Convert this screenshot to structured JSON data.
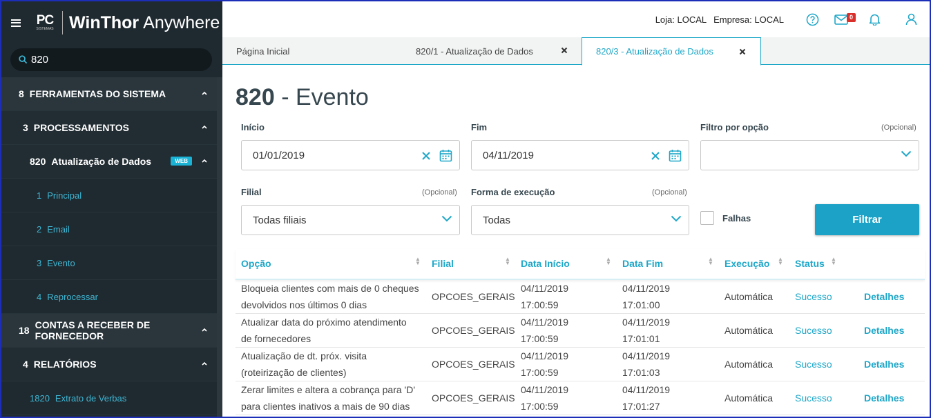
{
  "app": {
    "logo_text": "PC",
    "logo_subtext": "SISTEMAS",
    "brand_strong": "WinThor",
    "brand_light": "Anywhere"
  },
  "search": {
    "value": "820"
  },
  "menu": [
    {
      "number": "8",
      "label": "FERRAMENTAS DO SISTEMA",
      "level": 0
    },
    {
      "number": "3",
      "label": "PROCESSAMENTOS",
      "level": 1
    },
    {
      "number": "820",
      "label": "Atualização de Dados",
      "level": 2,
      "badge": "WEB"
    },
    {
      "number": "1",
      "label": "Principal",
      "level": 3
    },
    {
      "number": "2",
      "label": "Email",
      "level": 3
    },
    {
      "number": "3",
      "label": "Evento",
      "level": 3
    },
    {
      "number": "4",
      "label": "Reprocessar",
      "level": 3
    },
    {
      "number": "18",
      "label": "CONTAS A RECEBER DE FORNECEDOR",
      "level": 0
    },
    {
      "number": "4",
      "label": "RELATÓRIOS",
      "level": 1
    },
    {
      "number": "1820",
      "label": "Extrato de Verbas",
      "level": 4
    }
  ],
  "header": {
    "loja": "Loja: LOCAL",
    "empresa": "Empresa: LOCAL",
    "mail_count": "0"
  },
  "tabs": [
    {
      "label": "Página Inicial"
    },
    {
      "label": "820/1 - Atualização de Dados"
    },
    {
      "label": "820/3 - Atualização de Dados",
      "active": true
    }
  ],
  "page": {
    "title_number": "820",
    "title_text": "- Evento"
  },
  "form": {
    "inicio_label": "Início",
    "inicio_value": "01/01/2019",
    "fim_label": "Fim",
    "fim_value": "04/11/2019",
    "filtro_label": "Filtro por opção",
    "filtro_optional": "(Opcional)",
    "filtro_value": "",
    "filial_label": "Filial",
    "filial_optional": "(Opcional)",
    "filial_value": "Todas filiais",
    "forma_label": "Forma de execução",
    "forma_optional": "(Opcional)",
    "forma_value": "Todas",
    "falhas_label": "Falhas",
    "filtrar_button": "Filtrar"
  },
  "table": {
    "columns": [
      "Opção",
      "Filial",
      "Data Início",
      "Data Fim",
      "Execução",
      "Status"
    ],
    "rows": [
      {
        "opcao": [
          "Bloqueia clientes com mais de 0 cheques",
          "devolvidos nos últimos 0 dias"
        ],
        "filial": "OPCOES_GERAIS",
        "inicio": [
          "04/11/2019",
          "17:00:59"
        ],
        "fim": [
          "04/11/2019",
          "17:01:00"
        ],
        "execucao": "Automática",
        "status": "Sucesso",
        "acao": "Detalhes"
      },
      {
        "opcao": [
          "Atualizar data do próximo atendimento",
          "de fornecedores"
        ],
        "filial": "OPCOES_GERAIS",
        "inicio": [
          "04/11/2019",
          "17:00:59"
        ],
        "fim": [
          "04/11/2019",
          "17:01:01"
        ],
        "execucao": "Automática",
        "status": "Sucesso",
        "acao": "Detalhes"
      },
      {
        "opcao": [
          "Atualização de dt. próx. visita",
          "(roteirização de clientes)"
        ],
        "filial": "OPCOES_GERAIS",
        "inicio": [
          "04/11/2019",
          "17:00:59"
        ],
        "fim": [
          "04/11/2019",
          "17:01:03"
        ],
        "execucao": "Automática",
        "status": "Sucesso",
        "acao": "Detalhes"
      },
      {
        "opcao": [
          "Zerar limites e altera a cobrança para 'D'",
          "para clientes inativos a mais de 90 dias"
        ],
        "filial": "OPCOES_GERAIS",
        "inicio": [
          "04/11/2019",
          "17:00:59"
        ],
        "fim": [
          "04/11/2019",
          "17:01:27"
        ],
        "execucao": "Automática",
        "status": "Sucesso",
        "acao": "Detalhes"
      }
    ]
  },
  "colors": {
    "accent": "#1ea7c8",
    "sidebar_bg": "#1f2a30",
    "button": "#1ca2c6",
    "mail_badge": "#d9302c"
  }
}
